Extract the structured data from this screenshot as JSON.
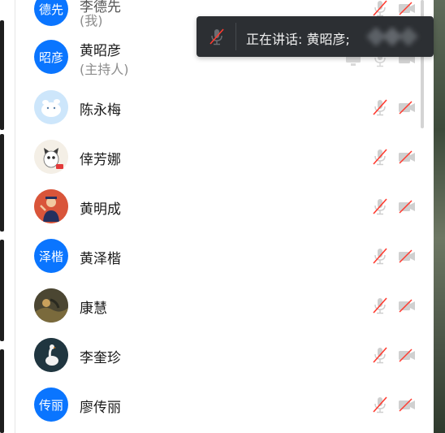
{
  "toast": {
    "speaking_text": "正在讲话: 黄昭彦;"
  },
  "participants": [
    {
      "avatar_text": "德先",
      "name": "李德先",
      "role": "(我)"
    },
    {
      "avatar_text": "昭彦",
      "name": "黄昭彦",
      "role": "(主持人)"
    },
    {
      "avatar_icon": "cartoon-cat-avatar",
      "name": "陈永梅"
    },
    {
      "avatar_icon": "cartoon-dog-avatar",
      "name": "倖芳娜"
    },
    {
      "avatar_icon": "cartoon-person-avatar",
      "name": "黄明成"
    },
    {
      "avatar_text": "泽楷",
      "name": "黄泽楷"
    },
    {
      "avatar_icon": "painting-avatar",
      "name": "康慧"
    },
    {
      "avatar_icon": "goose-avatar",
      "name": "李奎珍"
    },
    {
      "avatar_text": "传丽",
      "name": "廖传丽"
    }
  ],
  "colors": {
    "avatar_blue": "#0a75ff",
    "muted_red": "#ff3b30",
    "icon_gray": "#c8c8c8",
    "toast_bg": "#2c2f33"
  }
}
